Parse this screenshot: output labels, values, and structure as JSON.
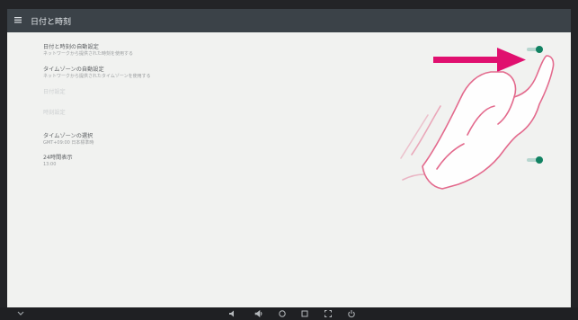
{
  "app": {
    "title": "日付と時刻"
  },
  "icons": {
    "menu": "menu-icon",
    "back": "back-icon",
    "gesture": "hand-pointer-icon",
    "arrow": "swipe-arrow-icon",
    "nav": [
      "volume-down-icon",
      "volume-up-icon",
      "home-icon",
      "recents-icon",
      "screenshot-icon",
      "power-icon"
    ]
  },
  "colors": {
    "toolbar": "#3b4248",
    "switch_on": "#118262",
    "arrow": "#e0106f"
  },
  "settings": [
    {
      "title": "日付と時刻の自動設定",
      "summary": "ネットワークから提供された時刻を使用する",
      "switch": true
    },
    {
      "title": "タイムゾーンの自動設定",
      "summary": "ネットワークから提供されたタイムゾーンを使用する",
      "switch": false
    },
    {
      "title": "日付設定",
      "summary": "",
      "disabled": true
    },
    {
      "title": "時刻設定",
      "summary": "",
      "disabled": true
    },
    {
      "title": "タイムゾーンの選択",
      "summary": "GMT+09:00 日本標準時"
    },
    {
      "title": "24時間表示",
      "summary": "13:00",
      "switch": true
    }
  ]
}
